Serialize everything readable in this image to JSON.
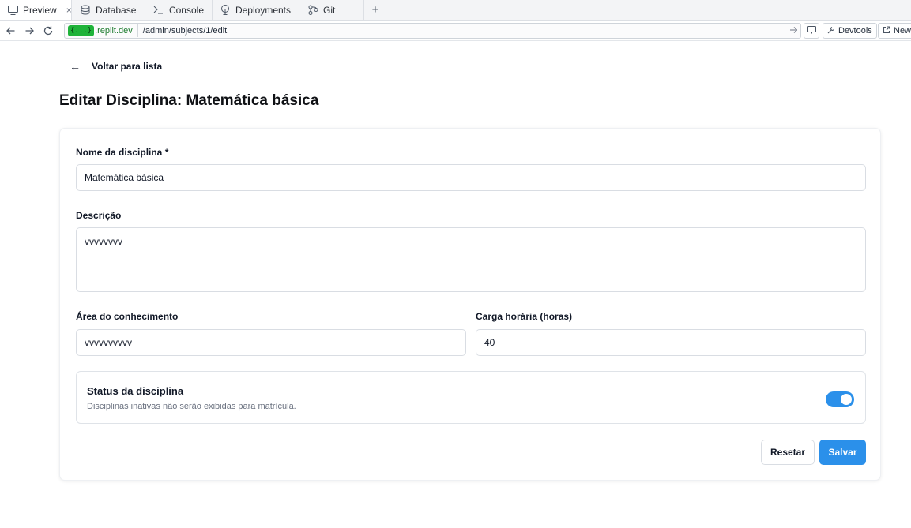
{
  "tabs": [
    {
      "label": "Preview",
      "icon": "monitor-icon",
      "active": true
    },
    {
      "label": "Database",
      "icon": "database-icon"
    },
    {
      "label": "Console",
      "icon": "terminal-icon"
    },
    {
      "label": "Deployments",
      "icon": "deployments-icon"
    },
    {
      "label": "Git",
      "icon": "git-icon"
    }
  ],
  "close_glyph": "×",
  "add_glyph": "+",
  "urlbar": {
    "domain_chip": "{...}",
    "domain": ".replit.dev",
    "path": "/admin/subjects/1/edit",
    "devtools_label": "Devtools",
    "newtab_label": "New"
  },
  "page": {
    "back_arrow": "←",
    "back_label": "Voltar para lista",
    "title": "Editar Disciplina: Matemática básica"
  },
  "form": {
    "name_label": "Nome da disciplina *",
    "name_value": "Matemática básica",
    "description_label": "Descrição",
    "description_value": "vvvvvvvv",
    "area_label": "Área do conhecimento",
    "area_value": "vvvvvvvvvv",
    "hours_label": "Carga horária (horas)",
    "hours_value": "40",
    "status_title": "Status da disciplina",
    "status_desc": "Disciplinas inativas não serão exibidas para matrícula.",
    "status_active": true,
    "reset_label": "Resetar",
    "save_label": "Salvar"
  },
  "colors": {
    "accent": "#2b90ea",
    "domain_chip": "#1fb33a"
  }
}
